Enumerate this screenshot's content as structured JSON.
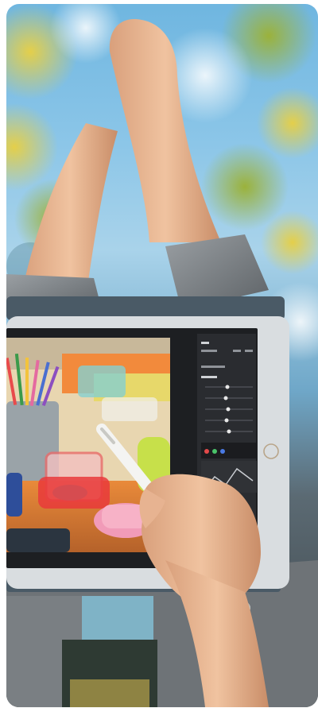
{
  "photo": {
    "subject": "",
    "colors": {
      "sky": "#7fc0e6",
      "foliage": "#c9b23a",
      "skin": "#e8b48f",
      "jeans": "#7a7f84",
      "tablet_frame": "#d9dde0",
      "tablet_case": "#4a5a66",
      "screen": "#1d1f22",
      "pencil": "#f4f4f2"
    }
  }
}
